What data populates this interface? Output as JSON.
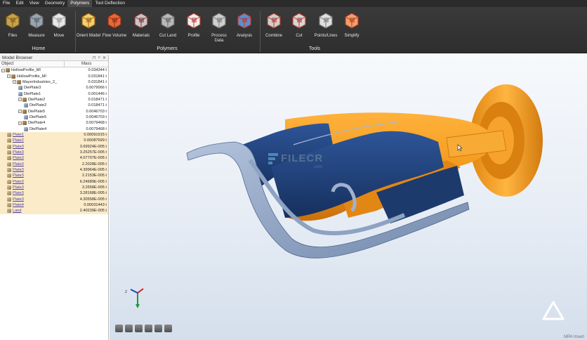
{
  "menu": [
    "File",
    "Edit",
    "View",
    "Geometry",
    "Polymers",
    "Tool Deflection"
  ],
  "menu_active": "Polymers",
  "ribbon": {
    "buttons": [
      {
        "id": "files",
        "line1": "Files",
        "line2": "",
        "icon": "folder-icon"
      },
      {
        "id": "measure",
        "line1": "Measure",
        "line2": "",
        "icon": "measure-icon"
      },
      {
        "id": "move",
        "line1": "Move",
        "line2": "",
        "icon": "move-icon"
      },
      {
        "id": "orient-model",
        "line1": "Orient Model",
        "line2": "",
        "icon": "orient-icon"
      },
      {
        "id": "flow-volume",
        "line1": "Flow Volume",
        "line2": "",
        "icon": "flow-volume-icon"
      },
      {
        "id": "materials",
        "line1": "Materials",
        "line2": "",
        "icon": "materials-icon"
      },
      {
        "id": "cut-land",
        "line1": "Cut Land",
        "line2": "",
        "icon": "cut-land-icon"
      },
      {
        "id": "profile",
        "line1": "Profile",
        "line2": "",
        "icon": "profile-icon"
      },
      {
        "id": "process-data",
        "line1": "Process",
        "line2": "Data",
        "icon": "process-data-icon"
      },
      {
        "id": "analysis",
        "line1": "Analysis",
        "line2": "",
        "icon": "analysis-icon"
      },
      {
        "id": "combine",
        "line1": "Combine",
        "line2": "",
        "icon": "combine-icon"
      },
      {
        "id": "cut",
        "line1": "Cut",
        "line2": "",
        "icon": "cut-icon"
      },
      {
        "id": "points-lines",
        "line1": "Points/Lines",
        "line2": "",
        "icon": "points-lines-icon"
      },
      {
        "id": "simplify",
        "line1": "Simplify",
        "line2": "",
        "icon": "simplify-icon"
      }
    ],
    "groups": {
      "home": "Home",
      "polymers": "Polymers",
      "tools": "Tools"
    }
  },
  "browser": {
    "title": "Model Browser",
    "col_object": "Object",
    "col_mass": "Mass",
    "rows": [
      {
        "name": "HollowProfile_MI",
        "mass": "0.034344 t",
        "level": 0,
        "icon": "group",
        "expander": "-",
        "hl": false,
        "u": false
      },
      {
        "name": "HollowProfile_MI",
        "mass": "0.031841 t",
        "level": 1,
        "icon": "group",
        "expander": "-",
        "hl": false,
        "u": false
      },
      {
        "name": "MayerIndustries_2_",
        "mass": "0.031841 t",
        "level": 2,
        "icon": "group",
        "expander": "-",
        "hl": false,
        "u": false
      },
      {
        "name": "DiePlate3",
        "mass": "0.0079066 t",
        "level": 3,
        "icon": "part",
        "expander": "",
        "hl": false,
        "u": false
      },
      {
        "name": "DiePlate1",
        "mass": "0.001446 t",
        "level": 3,
        "icon": "part",
        "expander": "",
        "hl": false,
        "u": false
      },
      {
        "name": "DiePlate2",
        "mass": "0.018471 t",
        "level": 3,
        "icon": "group",
        "expander": "-",
        "hl": false,
        "u": false
      },
      {
        "name": "DiePlate2",
        "mass": "0.018471 t",
        "level": 4,
        "icon": "part",
        "expander": "",
        "hl": false,
        "u": false
      },
      {
        "name": "DiePlate5",
        "mass": "0.0046703 t",
        "level": 3,
        "icon": "group",
        "expander": "-",
        "hl": false,
        "u": false
      },
      {
        "name": "DiePlate5",
        "mass": "0.0046703 t",
        "level": 4,
        "icon": "part",
        "expander": "",
        "hl": false,
        "u": false
      },
      {
        "name": "DiePlate4",
        "mass": "0.0079468 t",
        "level": 3,
        "icon": "group",
        "expander": "-",
        "hl": false,
        "u": false
      },
      {
        "name": "DiePlate4",
        "mass": "0.0079468 t",
        "level": 4,
        "icon": "part",
        "expander": "",
        "hl": false,
        "u": false
      },
      {
        "name": "Plate1",
        "mass": "0.00091915 t",
        "level": 1,
        "icon": "plate",
        "expander": "",
        "hl": true,
        "u": true
      },
      {
        "name": "Plate2",
        "mass": "0.00087699 t",
        "level": 1,
        "icon": "plate",
        "expander": "",
        "hl": true,
        "u": true
      },
      {
        "name": "Plate3",
        "mass": "3.69924E-005 t",
        "level": 1,
        "icon": "plate",
        "expander": "",
        "hl": true,
        "u": true
      },
      {
        "name": "Plate3",
        "mass": "3.25257E-005 t",
        "level": 1,
        "icon": "plate",
        "expander": "",
        "hl": true,
        "u": true
      },
      {
        "name": "Plate3",
        "mass": "4.07707E-005 t",
        "level": 1,
        "icon": "plate",
        "expander": "",
        "hl": true,
        "u": true
      },
      {
        "name": "Plate3",
        "mass": "2.2028E-005 t",
        "level": 1,
        "icon": "plate",
        "expander": "",
        "hl": true,
        "u": true
      },
      {
        "name": "Plate3",
        "mass": "4.39964E-005 t",
        "level": 1,
        "icon": "plate",
        "expander": "",
        "hl": true,
        "u": true
      },
      {
        "name": "Plate3",
        "mass": "2.2153E-005 t",
        "level": 1,
        "icon": "plate",
        "expander": "",
        "hl": true,
        "u": true
      },
      {
        "name": "Plate3",
        "mass": "6.24689E-005 t",
        "level": 1,
        "icon": "plate",
        "expander": "",
        "hl": true,
        "u": true
      },
      {
        "name": "Plate3",
        "mass": "3.2658E-005 t",
        "level": 1,
        "icon": "plate",
        "expander": "",
        "hl": true,
        "u": true
      },
      {
        "name": "Plate3",
        "mass": "3.28168E-005 t",
        "level": 1,
        "icon": "plate",
        "expander": "",
        "hl": true,
        "u": true
      },
      {
        "name": "Plate3",
        "mass": "4.30558E-005 t",
        "level": 1,
        "icon": "plate",
        "expander": "",
        "hl": true,
        "u": true
      },
      {
        "name": "Plate4",
        "mass": "0.00031443 t",
        "level": 1,
        "icon": "plate",
        "expander": "",
        "hl": true,
        "u": true
      },
      {
        "name": "Land",
        "mass": "2.40239E-005 t",
        "level": 1,
        "icon": "plate",
        "expander": "",
        "hl": true,
        "u": true
      }
    ]
  },
  "viewport": {
    "watermark": "FILECR",
    "watermark_sub": ".com",
    "brand": "MPA Insert"
  },
  "colors": {
    "accent_orange": "#f39a1e",
    "navy": "#1f3f78",
    "ribbon_bg": "#333333",
    "highlight_row": "#fcebc9"
  }
}
